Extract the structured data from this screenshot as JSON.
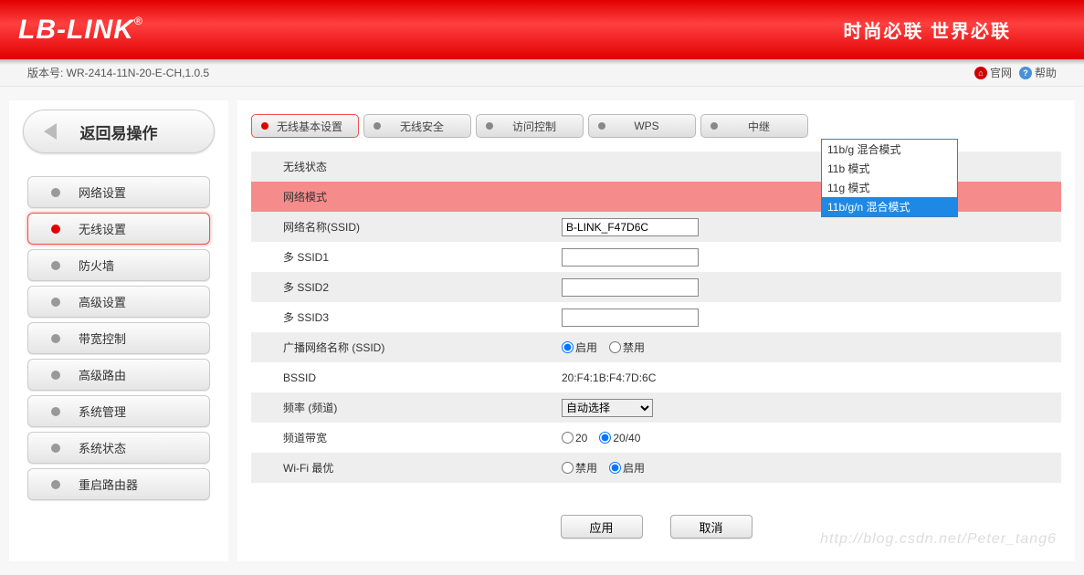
{
  "header": {
    "logo": "LB-LINK",
    "reg": "®",
    "slogan": "时尚必联  世界必联"
  },
  "version_bar": {
    "label": "版本号: WR-2414-11N-20-E-CH,1.0.5",
    "official": "官网",
    "help": "帮助"
  },
  "sidebar": {
    "back": "返回易操作",
    "items": [
      {
        "label": "网络设置",
        "active": false
      },
      {
        "label": "无线设置",
        "active": true
      },
      {
        "label": "防火墙",
        "active": false
      },
      {
        "label": "高级设置",
        "active": false
      },
      {
        "label": "带宽控制",
        "active": false
      },
      {
        "label": "高级路由",
        "active": false
      },
      {
        "label": "系统管理",
        "active": false
      },
      {
        "label": "系统状态",
        "active": false
      },
      {
        "label": "重启路由器",
        "active": false
      }
    ]
  },
  "tabs": [
    {
      "label": "无线基本设置",
      "active": true
    },
    {
      "label": "无线安全",
      "active": false
    },
    {
      "label": "访问控制",
      "active": false
    },
    {
      "label": "WPS",
      "active": false
    },
    {
      "label": "中继",
      "active": false
    }
  ],
  "dropdown": {
    "options": [
      {
        "label": "11b/g 混合模式",
        "selected": false
      },
      {
        "label": "11b 模式",
        "selected": false
      },
      {
        "label": "11g 模式",
        "selected": false
      },
      {
        "label": "11b/g/n 混合模式",
        "selected": true
      }
    ]
  },
  "form": {
    "wireless_status_label": "无线状态",
    "network_mode_label": "网络模式",
    "ssid_label": "网络名称(SSID)",
    "ssid_value": "B-LINK_F47D6C",
    "mssid1_label": "多 SSID1",
    "mssid1_value": "",
    "mssid2_label": "多 SSID2",
    "mssid2_value": "",
    "mssid3_label": "多 SSID3",
    "mssid3_value": "",
    "broadcast_label": "广播网络名称 (SSID)",
    "broadcast_enable": "启用",
    "broadcast_disable": "禁用",
    "bssid_label": "BSSID",
    "bssid_value": "20:F4:1B:F4:7D:6C",
    "channel_label": "频率 (频道)",
    "channel_value": "自动选择",
    "bandwidth_label": "频道带宽",
    "bandwidth_20": "20",
    "bandwidth_2040": "20/40",
    "wifi_opt_label": "Wi-Fi 最优",
    "wifi_opt_disable": "禁用",
    "wifi_opt_enable": "启用"
  },
  "buttons": {
    "apply": "应用",
    "cancel": "取消"
  },
  "watermark": "http://blog.csdn.net/Peter_tang6"
}
